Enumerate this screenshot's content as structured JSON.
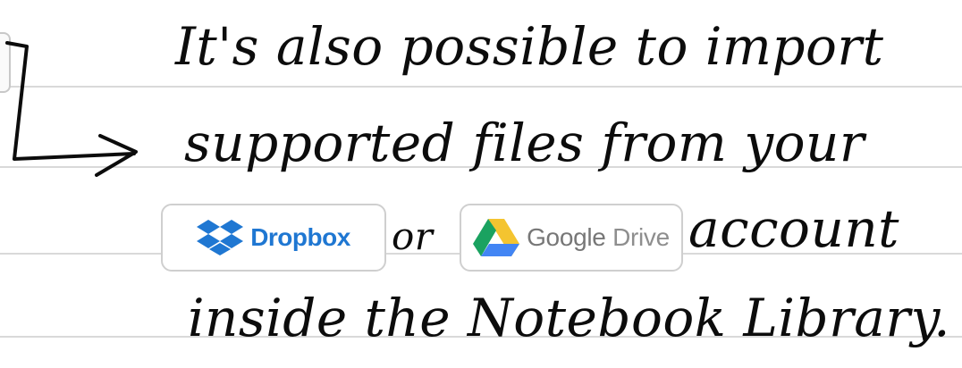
{
  "note": {
    "line1": "It's also possible to import",
    "line2": "supported files from your",
    "line3": "account",
    "line4": "inside the Notebook Library.",
    "or_word": "or"
  },
  "services": {
    "dropbox": {
      "label": "Dropbox",
      "icon": "dropbox-icon",
      "color": "#1f77d2"
    },
    "gdrive": {
      "label": "Google",
      "label2": "Drive",
      "icon": "google-drive-icon",
      "color": "#777777"
    }
  },
  "colors": {
    "ink": "#0c0c0c",
    "rule": "#d9d9d9",
    "button_border": "#cfcfcf"
  }
}
